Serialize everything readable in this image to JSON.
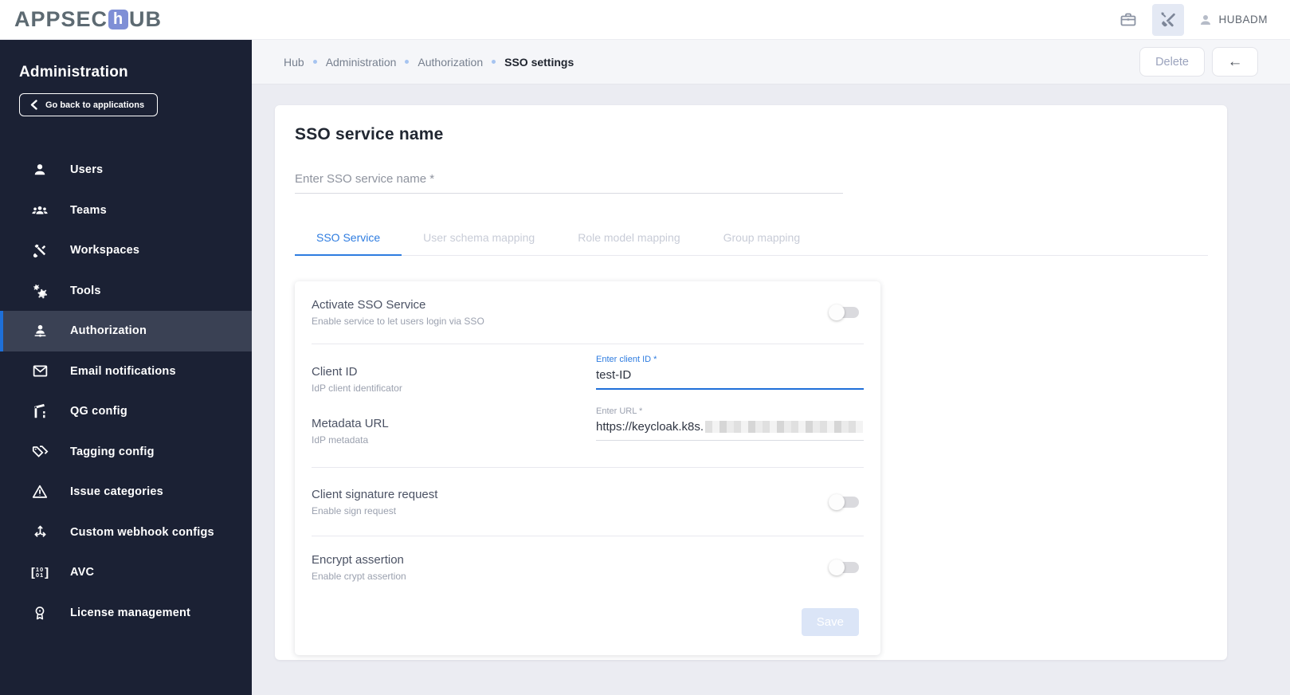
{
  "app": {
    "logo_prefix": "APPSEC",
    "logo_tile_letter": "h",
    "logo_suffix": "UB"
  },
  "topbar": {
    "icons": [
      "briefcase-icon",
      "tools-icon",
      "user-icon"
    ],
    "username": "HUBADM"
  },
  "sidebar": {
    "title": "Administration",
    "back_button_label": "Go back to applications",
    "items": [
      {
        "label": "Users",
        "icon": "user-icon",
        "active": false
      },
      {
        "label": "Teams",
        "icon": "people-icon",
        "active": false
      },
      {
        "label": "Workspaces",
        "icon": "crossed-tools-icon",
        "active": false
      },
      {
        "label": "Tools",
        "icon": "gears-icon",
        "active": false
      },
      {
        "label": "Authorization",
        "icon": "manage-account-icon",
        "active": true
      },
      {
        "label": "Email notifications",
        "icon": "envelope-icon",
        "active": false
      },
      {
        "label": "QG config",
        "icon": "gate-icon",
        "active": false
      },
      {
        "label": "Tagging config",
        "icon": "tags-icon",
        "active": false
      },
      {
        "label": "Issue categories",
        "icon": "warning-triangle-icon",
        "active": false
      },
      {
        "label": "Custom webhook configs",
        "icon": "split-arrows-icon",
        "active": false
      },
      {
        "label": "AVC",
        "icon": "binary-brackets-icon",
        "active": false
      },
      {
        "label": "License management",
        "icon": "license-badge-icon",
        "active": false
      }
    ]
  },
  "breadcrumb": {
    "items": [
      "Hub",
      "Administration",
      "Authorization",
      "SSO settings"
    ]
  },
  "toolbar": {
    "delete_label": "Delete",
    "back_arrow": "←"
  },
  "main": {
    "title": "SSO service name",
    "name_input": {
      "placeholder": "Enter SSO service name *",
      "value": ""
    },
    "tabs": [
      {
        "label": "SSO Service",
        "active": true
      },
      {
        "label": "User schema mapping",
        "active": false
      },
      {
        "label": "Role model mapping",
        "active": false
      },
      {
        "label": "Group mapping",
        "active": false
      }
    ],
    "form": {
      "rows": [
        {
          "type": "toggle",
          "label": "Activate SSO Service",
          "sublabel": "Enable service to let users login via SSO",
          "value": false
        },
        {
          "type": "text",
          "label": "Client ID",
          "sublabel": "IdP client identificator",
          "field_label": "Enter client ID *",
          "value": "test-ID",
          "focused": true
        },
        {
          "type": "text",
          "sublabel2": "redacted tail shown as pixelated blur",
          "label": "Metadata URL",
          "sublabel": "IdP metadata",
          "field_label": "Enter URL *",
          "value": "https://keycloak.k8s.",
          "focused": false
        },
        {
          "type": "toggle",
          "label": "Client signature request",
          "sublabel": "Enable sign request",
          "value": false
        },
        {
          "type": "toggle",
          "label": "Encrypt assertion",
          "sublabel": "Enable crypt assertion",
          "value": false
        }
      ],
      "save_label": "Save"
    }
  },
  "colors": {
    "accent_blue": "#2e7ce0",
    "focused_underline": "#1f6fd9",
    "sidebar_bg": "#1b2134",
    "sidebar_active_bg": "#3a4154",
    "sidebar_active_bar": "#1e6fd8",
    "logo_tile": "#7f8fd6",
    "content_bg": "#ebecf2",
    "crumb_bar_bg": "#f5f6f9",
    "crumb_dot": "#a6c4f0",
    "save_disabled_bg": "#dbe5f7"
  }
}
